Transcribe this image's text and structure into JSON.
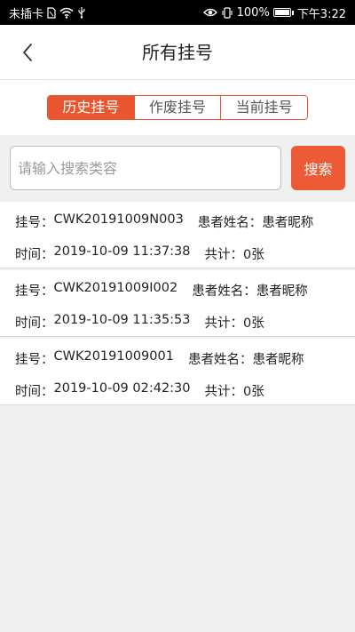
{
  "status_bar": {
    "carrier": "未插卡",
    "battery_percent": "100%",
    "battery_level": 1.0,
    "time": "下午3:22"
  },
  "header": {
    "title": "所有挂号"
  },
  "tabs": [
    {
      "label": "历史挂号",
      "active": true
    },
    {
      "label": "作废挂号",
      "active": false
    },
    {
      "label": "当前挂号",
      "active": false
    }
  ],
  "search": {
    "placeholder": "请输入搜索类容",
    "value": "",
    "button_label": "搜索"
  },
  "list_labels": {
    "number_label": "挂号：",
    "patient_label": "患者姓名：",
    "time_label": "时间：",
    "total_label": "共计："
  },
  "records": [
    {
      "number": "CWK20191009N003",
      "patient": "患者昵称",
      "time": "2019-10-09 11:37:38",
      "total": "0张"
    },
    {
      "number": "CWK20191009I002",
      "patient": "患者昵称",
      "time": "2019-10-09 11:35:53",
      "total": "0张"
    },
    {
      "number": "CWK20191009001",
      "patient": "患者昵称",
      "time": "2019-10-09 02:42:30",
      "total": "0张"
    }
  ],
  "colors": {
    "accent": "#e8552f",
    "search_button": "#ec5b36",
    "page_bg": "#f0f0f0"
  },
  "icons": {
    "back": "chevron-left-icon",
    "sim": "no-sim-icon",
    "wifi": "wifi-icon",
    "usb": "usb-icon",
    "eye": "eye-icon",
    "vibrate": "vibrate-icon",
    "battery": "battery-icon"
  }
}
